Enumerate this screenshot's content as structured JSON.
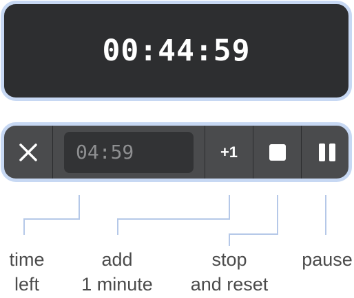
{
  "display": {
    "time": "00:44:59"
  },
  "controls": {
    "close_icon": "close-icon",
    "time_left": "04:59",
    "plus_label": "+1",
    "stop_icon": "stop-icon",
    "pause_icon": "pause-icon"
  },
  "labels": {
    "time_left": [
      "time",
      "left"
    ],
    "add_minute": [
      "add",
      "1 minute"
    ],
    "stop_reset": [
      "stop",
      "and reset"
    ],
    "pause": [
      "pause"
    ]
  },
  "colors": {
    "panel_dark": "#2d2e30",
    "bar": "#4a4b4d",
    "border": "#c7d8f3",
    "leader_lines": "#b5c8e8"
  }
}
